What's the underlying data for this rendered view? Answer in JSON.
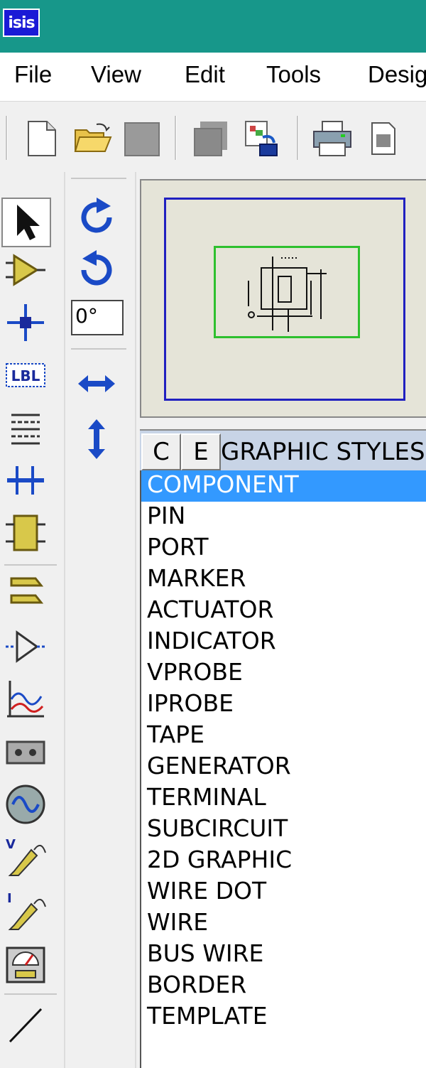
{
  "app": {
    "logo_text": "isis"
  },
  "menu": [
    "File",
    "View",
    "Edit",
    "Tools",
    "Design"
  ],
  "rotation": {
    "value": "0°"
  },
  "panel": {
    "buttons": [
      "C",
      "E"
    ],
    "title": "GRAPHIC STYLES",
    "items": [
      "COMPONENT",
      "PIN",
      "PORT",
      "MARKER",
      "ACTUATOR",
      "INDICATOR",
      "VPROBE",
      "IPROBE",
      "TAPE",
      "GENERATOR",
      "TERMINAL",
      "SUBCIRCUIT",
      "2D GRAPHIC",
      "WIRE DOT",
      "WIRE",
      "BUS WIRE",
      "BORDER",
      "TEMPLATE"
    ],
    "selected_index": 0
  },
  "icons": {
    "toolbar": [
      "new-file-icon",
      "open-folder-icon",
      "save-icon",
      "import-icon",
      "export-icon",
      "print-icon",
      "print-area-icon"
    ],
    "left": [
      "selection-mode-icon",
      "component-mode-icon",
      "junction-dot-icon",
      "wire-label-icon",
      "text-script-icon",
      "bus-icon",
      "subcircuit-icon",
      "terminal-icon",
      "device-pin-icon",
      "graph-icon",
      "tape-recorder-icon",
      "generator-icon",
      "voltage-probe-icon",
      "current-probe-icon",
      "virtual-instrument-icon",
      "line-2d-icon"
    ],
    "mid": [
      "rotate-clockwise-icon",
      "rotate-anticlockwise-icon",
      "mirror-horizontal-icon",
      "mirror-vertical-icon"
    ]
  },
  "colors": {
    "titlebar": "#17978a",
    "selection": "#3399ff",
    "sheet_border": "#2020c0",
    "view_window": "#2ec02e"
  }
}
